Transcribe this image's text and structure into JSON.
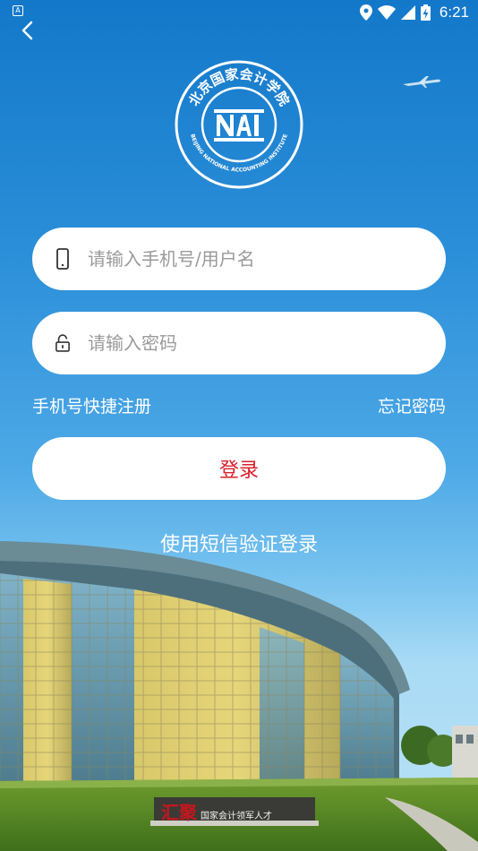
{
  "status_bar": {
    "notification_glyph": "A",
    "time": "6:21"
  },
  "logo": {
    "top_text": "北京国家会计学院",
    "bottom_text": "BEIJING NATIONAL ACCOUNTING INSTITUTE",
    "monogram": "NAI"
  },
  "login_form": {
    "phone_placeholder": "请输入手机号/用户名",
    "password_placeholder": "请输入密码",
    "register_link": "手机号快捷注册",
    "forgot_link": "忘记密码",
    "login_button": "登录",
    "sms_login_link": "使用短信验证登录"
  },
  "banner": {
    "main": "汇聚",
    "sub": "国家会计领军人才"
  },
  "colors": {
    "accent_red": "#d8202a",
    "sky_top": "#1378c9",
    "sky_bottom": "#b9e2f6"
  },
  "icons": [
    "wifi-icon",
    "back-arrow-icon",
    "phone-icon",
    "lock-icon"
  ]
}
